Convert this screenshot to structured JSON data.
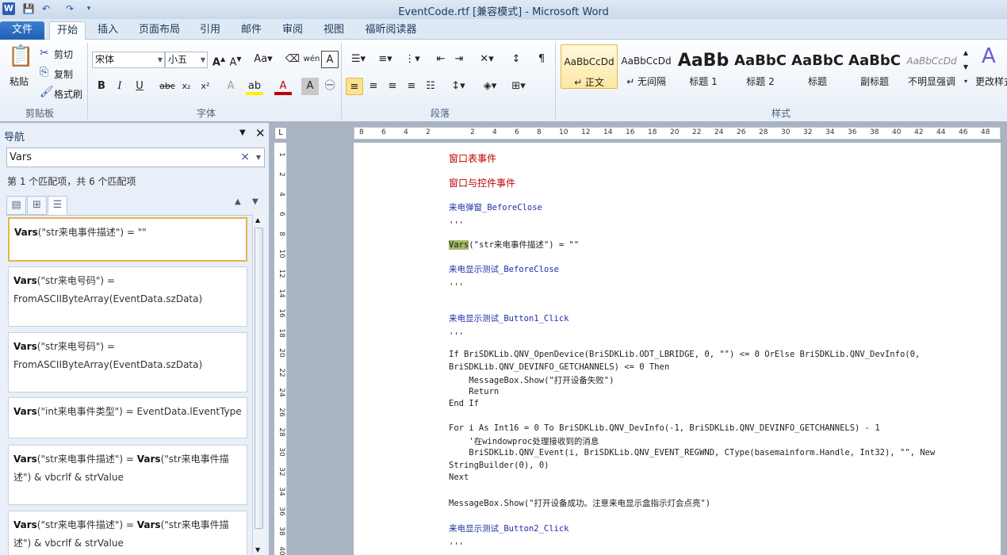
{
  "window": {
    "title": "EventCode.rtf [兼容模式] - Microsoft Word",
    "app_icon": "W"
  },
  "ribbon_tabs": [
    "文件",
    "开始",
    "插入",
    "页面布局",
    "引用",
    "邮件",
    "审阅",
    "视图",
    "福昕阅读器"
  ],
  "clipboard": {
    "paste": "粘贴",
    "cut": "剪切",
    "copy": "复制",
    "format_painter": "格式刷",
    "label": "剪贴板"
  },
  "font": {
    "name": "宋体",
    "size": "小五",
    "label": "字体"
  },
  "paragraph": {
    "label": "段落"
  },
  "styles": {
    "label": "样式",
    "change_styles": "更改样式",
    "items": [
      {
        "sample": "AaBbCcDd",
        "name": "↵ 正文"
      },
      {
        "sample": "AaBbCcDd",
        "name": "↵ 无间隔"
      },
      {
        "sample": "AaBb",
        "name": "标题 1"
      },
      {
        "sample": "AaBbC",
        "name": "标题 2"
      },
      {
        "sample": "AaBbC",
        "name": "标题"
      },
      {
        "sample": "AaBbC",
        "name": "副标题"
      },
      {
        "sample": "AaBbCcDd",
        "name": "不明显强调"
      }
    ]
  },
  "nav": {
    "title": "导航",
    "search_value": "Vars",
    "match_info": "第 1 个匹配项，共 6 个匹配项",
    "results": [
      "Vars(\"str来电事件描述\") = \"\"",
      "Vars(\"str来电号码\") = FromASCIIByteArray(EventData.szData)",
      "Vars(\"str来电号码\") = FromASCIIByteArray(EventData.szData)",
      "Vars(\"int来电事件类型\") = EventData.lEventType",
      "Vars(\"str来电事件描述\") = Vars(\"str来电事件描述\") & vbcrlf & strValue",
      "Vars(\"str来电事件描述\") = Vars(\"str来电事件描述\") & vbcrlf & strValue"
    ]
  },
  "ruler": {
    "h_numbers": [
      "8",
      "6",
      "4",
      "2",
      "",
      "2",
      "4",
      "6",
      "8",
      "10",
      "12",
      "14",
      "16",
      "18",
      "20",
      "22",
      "24",
      "26",
      "28",
      "30",
      "32",
      "34",
      "36",
      "38",
      "40",
      "42",
      "44",
      "46",
      "48"
    ],
    "v_numbers": [
      "1",
      "2",
      "4",
      "6",
      "8",
      "10",
      "12",
      "14",
      "16",
      "18",
      "20",
      "22",
      "24",
      "26",
      "28",
      "30",
      "32",
      "34",
      "36",
      "38",
      "40"
    ]
  },
  "document": {
    "lines": [
      "窗口表事件",
      "窗口与控件事件",
      "来电弹窗_BeforeClose",
      "'''",
      "(\"str来电事件描述\") = \"\"",
      "来电显示测试_BeforeClose",
      "'''",
      "来电显示测试_Button1_Click",
      "'''",
      "If BriSDKLib.QNV_OpenDevice(BriSDKLib.ODT_LBRIDGE, 0, \"\") <= 0 OrElse BriSDKLib.QNV_DevInfo(0,",
      "BriSDKLib.QNV_DEVINFO_GETCHANNELS) <= 0 Then",
      "    MessageBox.Show(\"打开设备失败\")",
      "    Return",
      "End If",
      "For i As Int16 = 0 To BriSDKLib.QNV_DevInfo(-1, BriSDKLib.QNV_DEVINFO_GETCHANNELS) - 1",
      "    '在windowproc处理接收到的消息",
      "    BriSDKLib.QNV_Event(i, BriSDKLib.QNV_EVENT_REGWND, CType(basemainform.Handle, Int32), \"\", New",
      "StringBuilder(0), 0)",
      "Next",
      "MessageBox.Show(\"打开设备成功。注意来电显示盒指示灯会点亮\")",
      "来电显示测试_Button2_Click",
      "'''"
    ],
    "highlight_word": "Vars"
  }
}
